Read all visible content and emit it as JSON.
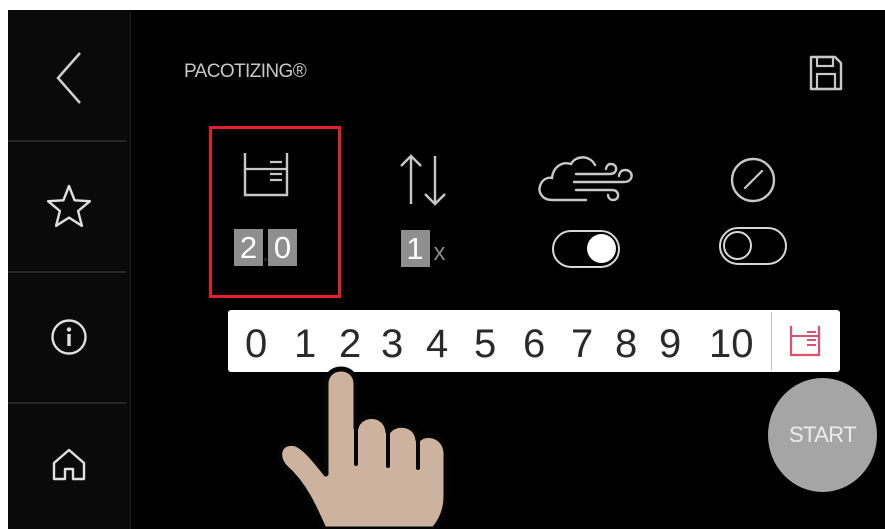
{
  "header": {
    "title": "PACOTIZING®",
    "save_icon": "save-icon"
  },
  "sidebar": {
    "items": [
      {
        "name": "back",
        "icon": "chevron-left-icon"
      },
      {
        "name": "favorites",
        "icon": "star-icon"
      },
      {
        "name": "info",
        "icon": "info-icon"
      },
      {
        "name": "home",
        "icon": "home-icon"
      }
    ]
  },
  "params": {
    "portions": {
      "icon": "beaker-icon",
      "digits": [
        "2",
        "0"
      ],
      "selected": true
    },
    "repeat": {
      "icon": "up-down-arrows-icon",
      "value": "1",
      "suffix": "x"
    },
    "air": {
      "icon": "cloud-wind-icon",
      "toggle_on": true
    },
    "pressure": {
      "icon": "gauge-icon",
      "toggle_on": false
    }
  },
  "picker": {
    "numbers": [
      "0",
      "1",
      "2",
      "3",
      "4",
      "5",
      "6",
      "7",
      "8",
      "9",
      "10"
    ],
    "end_icon": "beaker-icon"
  },
  "start_label": "START",
  "colors": {
    "highlight": "#e2202a",
    "accent_pink": "#e0506e",
    "button_grey": "#a5a5a5"
  }
}
